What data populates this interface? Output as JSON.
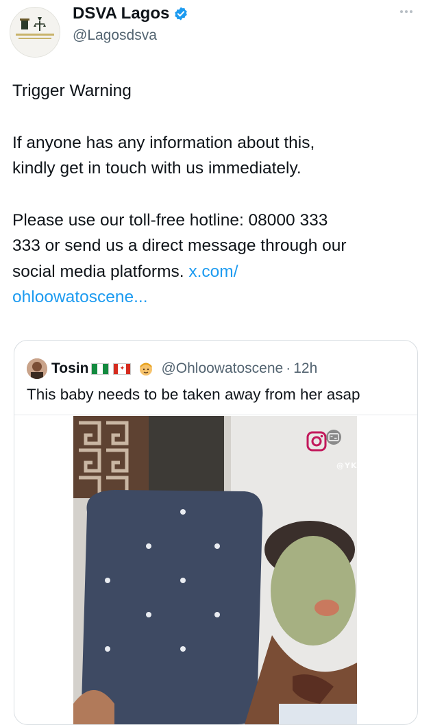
{
  "author": {
    "display_name": "DSVA Lagos",
    "handle": "@Lagosdsva",
    "verified": true,
    "avatar_icon": "dsva-logo-icon"
  },
  "tweet": {
    "line1": "Trigger Warning",
    "para2_line1": "If anyone has any information about this,",
    "para2_line2": "kindly get in touch with us immediately.",
    "para3_line1": "Please use our toll-free hotline: 08000 333",
    "para3_line2": "333 or send us a direct message through our",
    "para3_line3": "social media platforms.",
    "link_part1": "x.com/",
    "link_part2": "ohloowatoscene..."
  },
  "quote": {
    "name": "Tosin",
    "handle": "@Ohloowatoscene",
    "separator": "·",
    "time": "12h",
    "text": "This baby needs to be taken away from her asap",
    "flags": [
      "nigeria-flag",
      "canada-flag"
    ],
    "emoji": "blond-person-emoji"
  },
  "media": {
    "watermark": "@YK"
  },
  "colors": {
    "link": "#1d9bf0",
    "verified": "#1d9bf0",
    "secondary_text": "#536471"
  }
}
